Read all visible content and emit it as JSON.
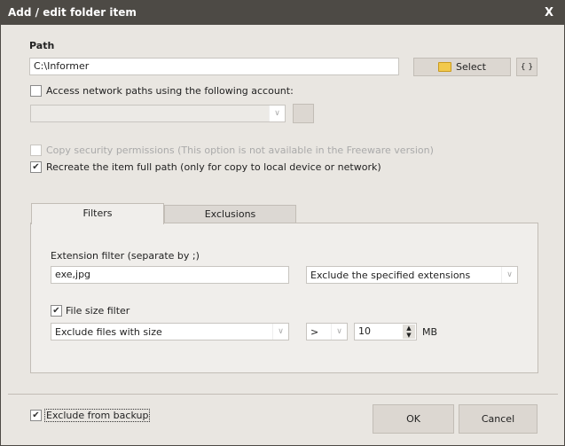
{
  "window": {
    "title": "Add / edit folder item",
    "close": "X"
  },
  "path": {
    "label": "Path",
    "value": "C:\\Informer",
    "select_label": "Select",
    "braces_label": "{ }"
  },
  "network": {
    "checkbox_label": "Access network paths using the following account:",
    "checked": false,
    "account_value": ""
  },
  "copy_security": {
    "label": "Copy security permissions (This option is not available in the Freeware version)",
    "checked": false,
    "disabled": true
  },
  "recreate_path": {
    "label": "Recreate the item full path (only for copy to local device or network)",
    "checked": true
  },
  "tabs": [
    {
      "label": "Filters",
      "active": true
    },
    {
      "label": "Exclusions",
      "active": false
    }
  ],
  "filters": {
    "extension_label": "Extension filter (separate by ;)",
    "extension_value": "exe,jpg",
    "extension_mode": "Exclude the specified extensions",
    "size_filter_label": "File size filter",
    "size_filter_checked": true,
    "size_mode": "Exclude files with size",
    "operator": ">",
    "size_value": "10",
    "unit": "MB"
  },
  "footer": {
    "exclude_label": "Exclude from backup",
    "exclude_checked": true,
    "ok": "OK",
    "cancel": "Cancel"
  }
}
